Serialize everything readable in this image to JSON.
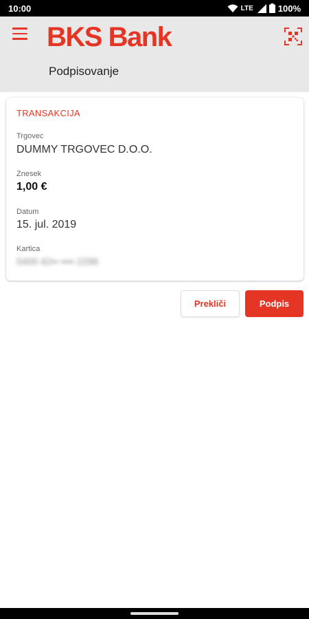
{
  "status_bar": {
    "time": "10:00",
    "network": "LTE",
    "battery": "100%"
  },
  "header": {
    "logo": "BKS Bank",
    "page_title": "Podpisovanje"
  },
  "transaction": {
    "section_title": "TRANSAKCIJA",
    "merchant_label": "Trgovec",
    "merchant_value": "DUMMY TRGOVEC D.O.O.",
    "amount_label": "Znesek",
    "amount_value": "1,00 €",
    "date_label": "Datum",
    "date_value": "15. jul. 2019",
    "card_label": "Kartica",
    "card_value": "5400 42•• •••• 2298"
  },
  "actions": {
    "cancel_label": "Prekliči",
    "sign_label": "Podpis"
  },
  "colors": {
    "accent": "#e53525",
    "header_bg": "#e8e8e8"
  },
  "icons": {
    "menu": "hamburger-menu-icon",
    "scan": "qr-scan-icon"
  }
}
